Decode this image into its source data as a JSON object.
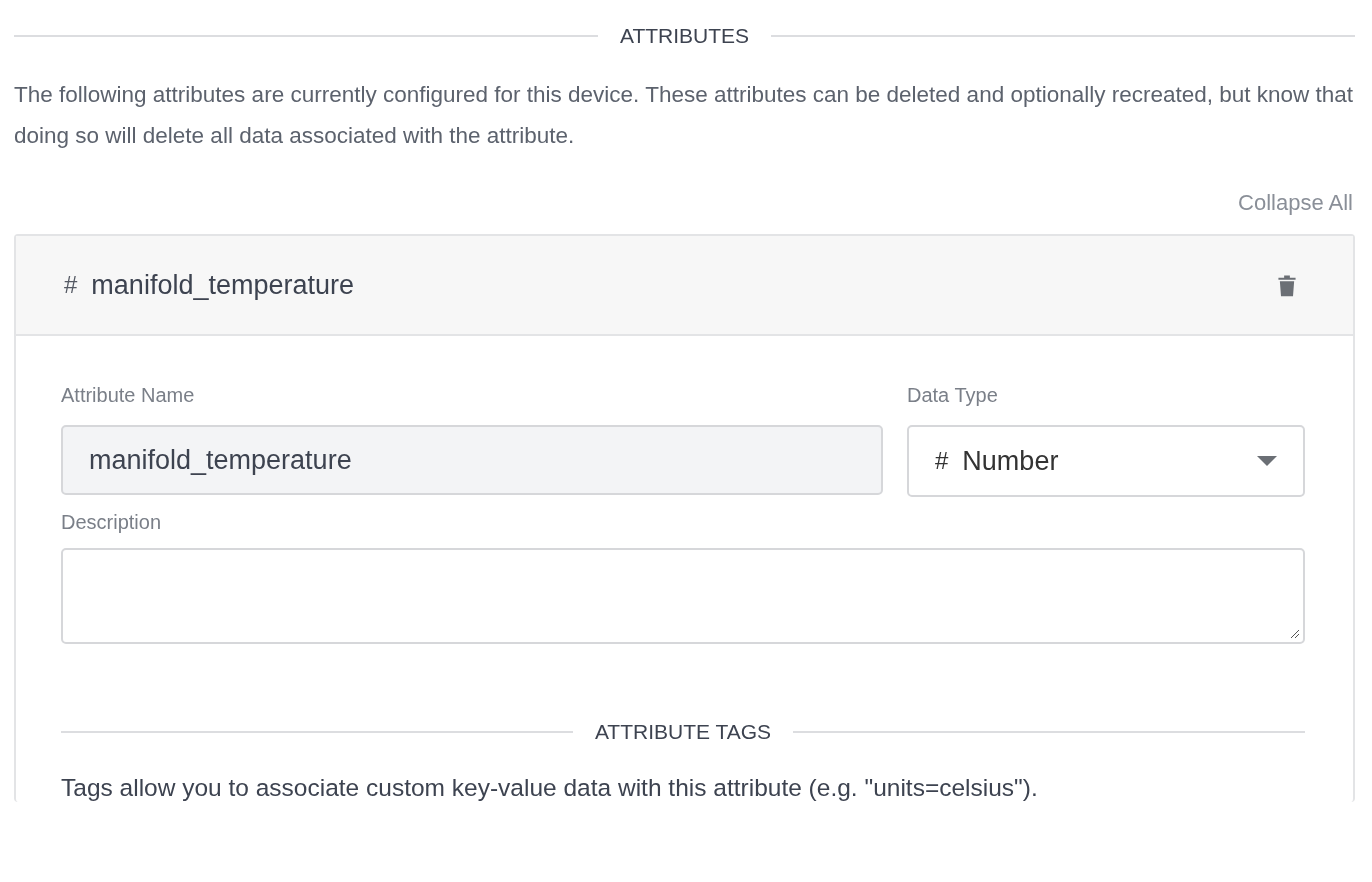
{
  "section_title": "ATTRIBUTES",
  "intro": "The following attributes are currently configured for this device. These attributes can be deleted and optionally recreated, but know that doing so will delete all data associated with the attribute.",
  "collapse_all": "Collapse All",
  "attribute": {
    "type_symbol": "#",
    "name": "manifold_temperature",
    "expanded": true,
    "fields": {
      "name_label": "Attribute Name",
      "name_value": "manifold_temperature",
      "type_label": "Data Type",
      "type_symbol": "#",
      "type_value": "Number",
      "description_label": "Description"
    },
    "tags_title": "ATTRIBUTE TAGS",
    "tags_text": "Tags allow you to associate custom key-value data with this attribute (e.g. \"units=celsius\")."
  }
}
